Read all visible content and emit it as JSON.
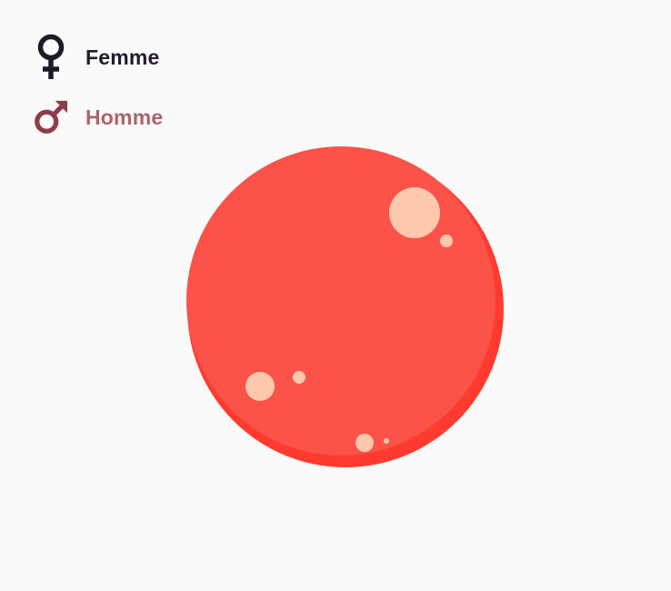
{
  "legend": {
    "items": [
      {
        "label": "Femme",
        "icon": "female-symbol-icon",
        "color": "#1f1a2a"
      },
      {
        "label": "Homme",
        "icon": "male-symbol-icon",
        "color": "#8c3d4a"
      }
    ]
  },
  "blob": {
    "fill": "#fb5249",
    "shadow": "#ff3a2e",
    "spot_color": "#fdc8ac"
  }
}
